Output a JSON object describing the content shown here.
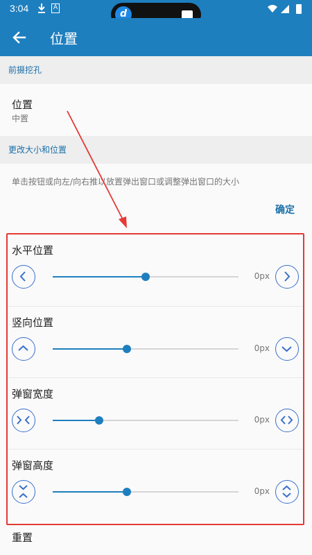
{
  "status_bar": {
    "time": "3:04",
    "notification_letter": "A",
    "pill_letter": "d"
  },
  "app_bar": {
    "title": "位置"
  },
  "sections": {
    "front_camera": {
      "header": "前摄挖孔"
    },
    "resize": {
      "header": "更改大小和位置"
    }
  },
  "position_pref": {
    "title": "位置",
    "summary": "中置"
  },
  "description": "单击按钮或向左/向右推以放置弹出窗口或调整弹出窗口的大小",
  "confirm_label": "确定",
  "sliders": [
    {
      "title": "水平位置",
      "value_text": "0px",
      "fraction": 0.5,
      "left_icon": "chevron-left-icon",
      "right_icon": "chevron-right-icon"
    },
    {
      "title": "竖向位置",
      "value_text": "0px",
      "fraction": 0.4,
      "left_icon": "chevron-up-icon",
      "right_icon": "chevron-down-icon"
    },
    {
      "title": "弹窗宽度",
      "value_text": "0px",
      "fraction": 0.25,
      "left_icon": "shrink-horizontal-icon",
      "right_icon": "expand-horizontal-icon"
    },
    {
      "title": "弹窗高度",
      "value_text": "0px",
      "fraction": 0.4,
      "left_icon": "shrink-vertical-icon",
      "right_icon": "expand-vertical-icon"
    }
  ],
  "reset_label": "重置",
  "colors": {
    "primary": "#1e7fbf",
    "highlight_border": "#e53935",
    "annotation_arrow": "#e53935",
    "icon_blue": "#3a6fcb"
  }
}
